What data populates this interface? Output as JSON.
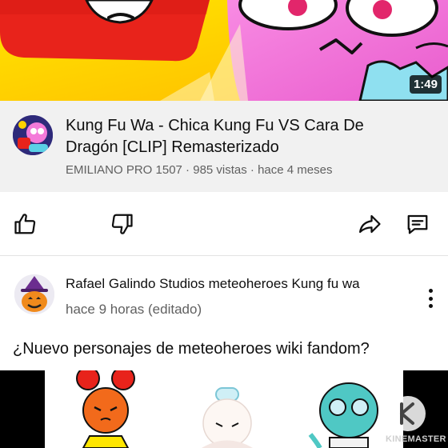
{
  "video": {
    "duration": "1:49",
    "title": "Kung Fu Wa - Chica Kung Fu VS Cara De Dragón [CLIP] Remasterizado",
    "channel": "EMILIANO PRO 1507",
    "meta": "EMILIANO PRO 1507 · 985 vistas · hace 4 meses"
  },
  "actions": [
    {
      "icon": "thumbs-up-icon"
    },
    {
      "icon": "thumbs-down-icon"
    },
    {
      "icon": "share-icon"
    },
    {
      "icon": "comment-icon"
    }
  ],
  "comment": {
    "author": "Rafael Galindo Studios meteoheroes Kung fu wa",
    "time": "hace 9 horas (editado)",
    "text": "¿Nuevo personajes de meteoheroes wiki fandom?"
  },
  "watermark": {
    "text": "KINEMASTER"
  },
  "colors": {
    "thumb_yellow": "#ffd200",
    "thumb_red": "#e8231b",
    "thumb_pink": "#f47ad9",
    "info_bg": "#f1f1f1",
    "meta_gray": "#606060"
  }
}
